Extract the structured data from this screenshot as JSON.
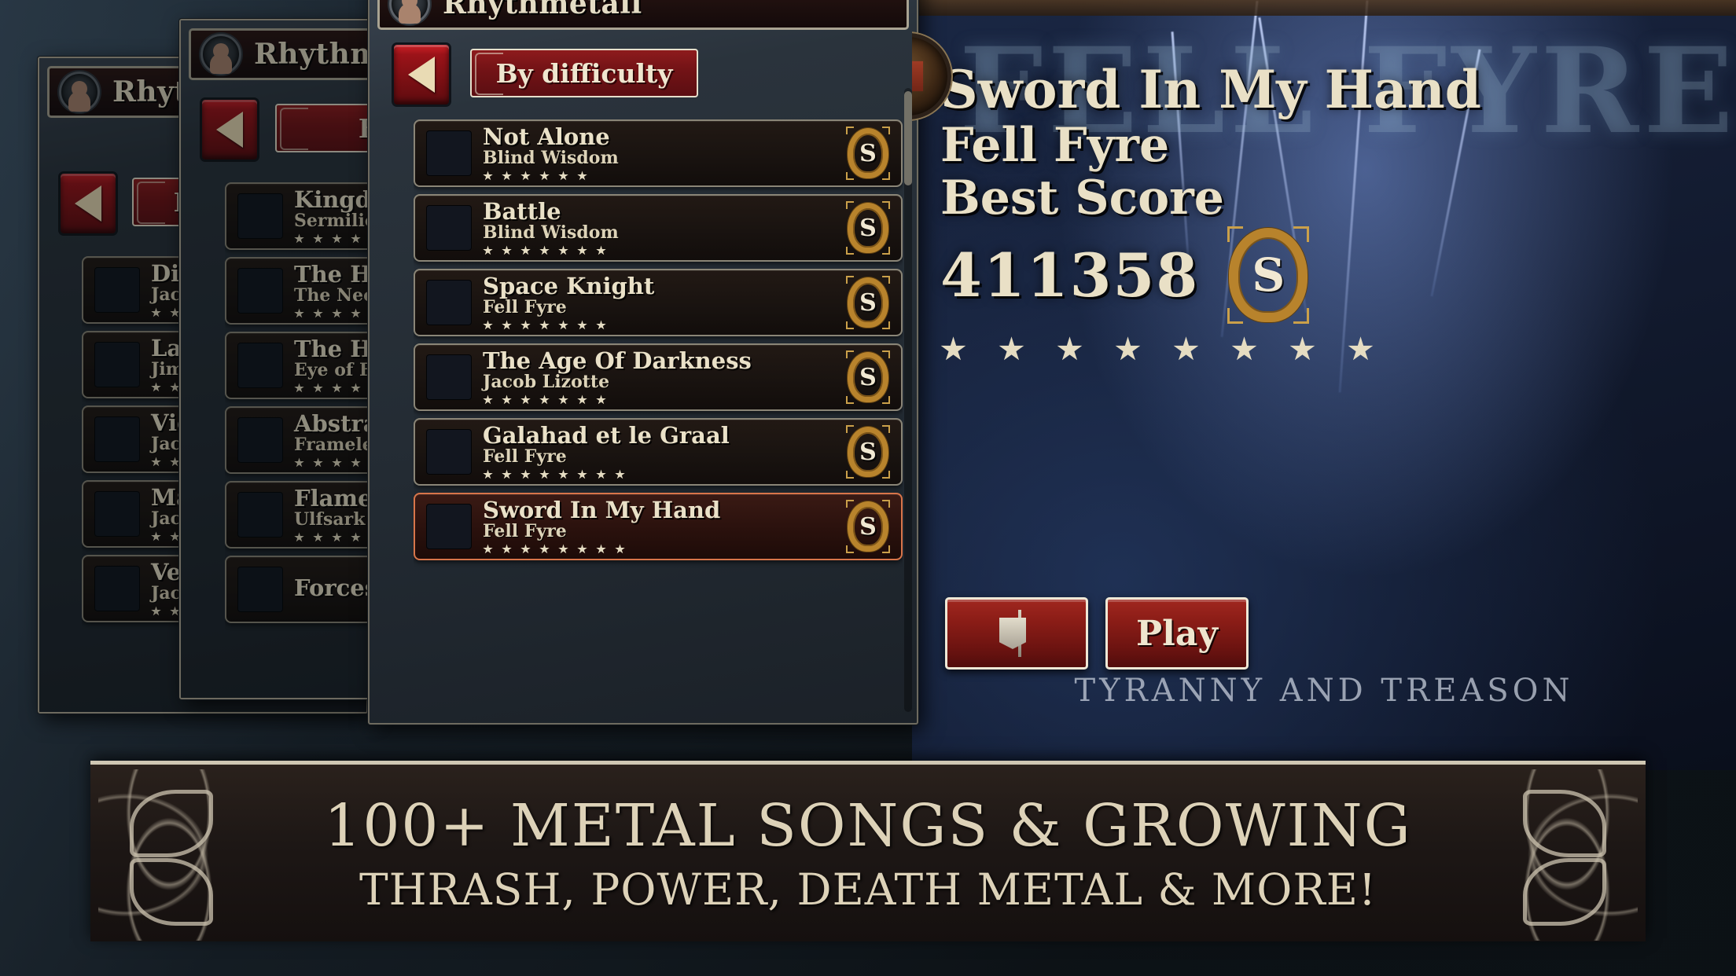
{
  "window_back": {
    "account_name": "Rhythmetall",
    "sort_label": "By difficulty",
    "songs": [
      {
        "title": "Digit",
        "artist": "Jacob",
        "stars": 4
      },
      {
        "title": "Lacer",
        "artist": "Jimmy",
        "stars": 4
      },
      {
        "title": "Viole",
        "artist": "Jacob",
        "stars": 4
      },
      {
        "title": "Malic",
        "artist": "Jacob",
        "stars": 4
      },
      {
        "title": "Veno",
        "artist": "Jacob",
        "stars": 4
      }
    ]
  },
  "window_mid": {
    "account_name": "Rhythmetall",
    "sort_label": "By dif",
    "songs": [
      {
        "title": "Kingdom O",
        "artist": "Sermilion",
        "stars": 6
      },
      {
        "title": "The Hologr",
        "artist": "The Neologist",
        "stars": 6
      },
      {
        "title": "The House",
        "artist": "Eye of Fenris",
        "stars": 6
      },
      {
        "title": "Abstract",
        "artist": "Frameless Sca",
        "stars": 6
      },
      {
        "title": "Flames Of",
        "artist": "Ulfsark",
        "stars": 6
      },
      {
        "title": "Forces of F",
        "artist": "",
        "stars": 0
      }
    ]
  },
  "window_front": {
    "account_name": "Rhythmetall",
    "sort_label": "By difficulty",
    "back_icon": "left-triangle-icon",
    "songs": [
      {
        "title": "Not Alone",
        "artist": "Blind Wisdom",
        "stars": 6,
        "rank": "S",
        "selected": false
      },
      {
        "title": "Battle",
        "artist": "Blind Wisdom",
        "stars": 7,
        "rank": "S",
        "selected": false
      },
      {
        "title": "Space Knight",
        "artist": "Fell Fyre",
        "stars": 7,
        "rank": "S",
        "selected": false
      },
      {
        "title": "The Age Of Darkness",
        "artist": "Jacob Lizotte",
        "stars": 7,
        "rank": "S",
        "selected": false
      },
      {
        "title": "Galahad et le Graal",
        "artist": "Fell Fyre",
        "stars": 8,
        "rank": "S",
        "selected": false
      },
      {
        "title": "Sword In My Hand",
        "artist": "Fell Fyre",
        "stars": 8,
        "rank": "S",
        "selected": true
      }
    ]
  },
  "detail": {
    "art_wordmark": "FELL FYRE",
    "title": "Sword In My Hand",
    "artist": "Fell Fyre",
    "best_score_label": "Best Score",
    "best_score_value": "411358",
    "rank": "S",
    "stars": 8,
    "album_subtitle": "TYRANNY AND TREASON",
    "buttons": {
      "flag_label": "",
      "flag_icon": "banner-flag-icon",
      "play_label": "Play"
    }
  },
  "banner": {
    "line1": "100+ METAL SONGS & GROWING",
    "line2": "THRASH, POWER, DEATH METAL & MORE!"
  },
  "colors": {
    "accent_red": "#8c1d17",
    "parchment": "#e9e0c6",
    "frame": "#8a8577",
    "selected_border": "#d8754a",
    "gold": "#b8832c"
  }
}
